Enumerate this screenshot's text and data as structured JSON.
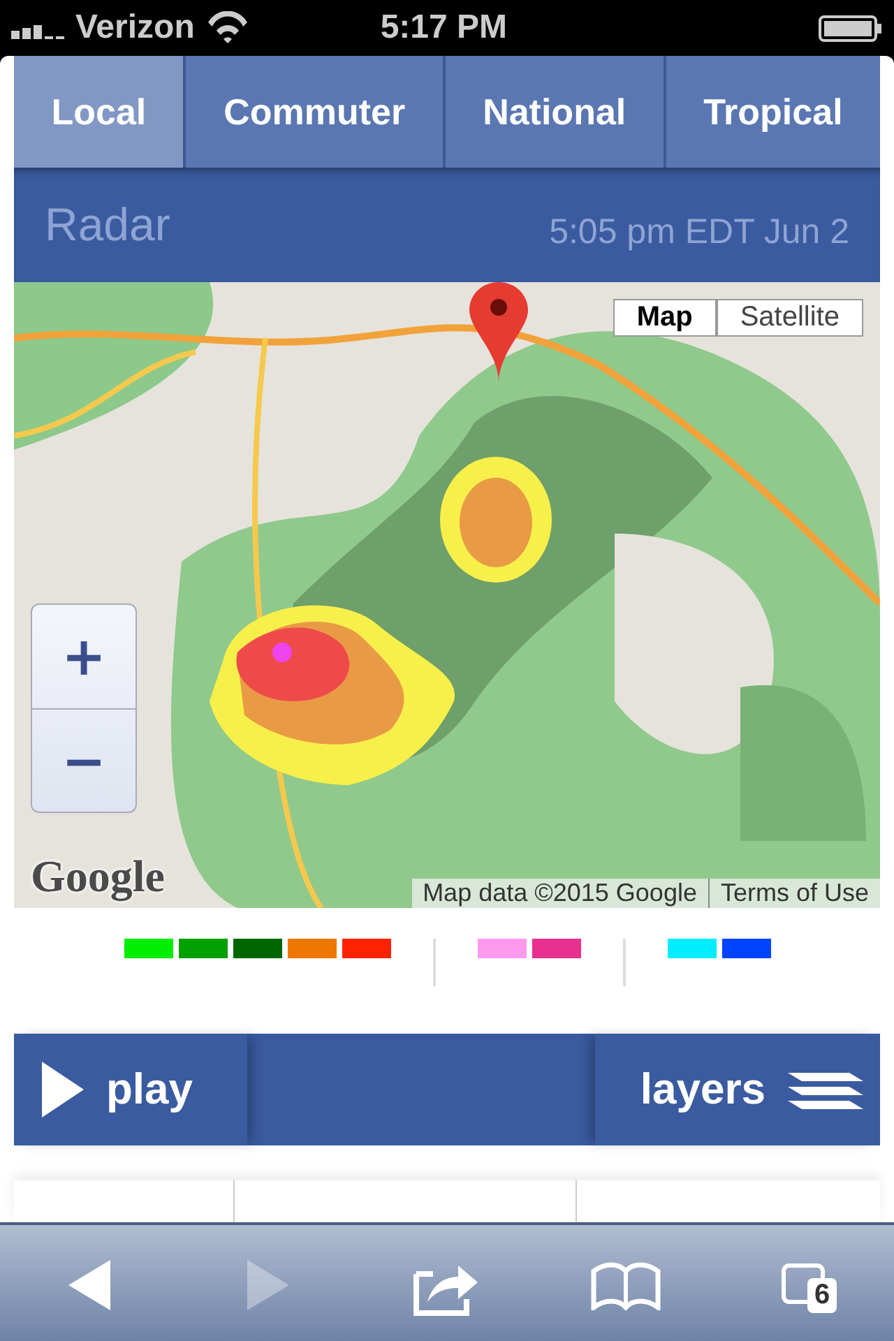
{
  "status_bar": {
    "carrier": "Verizon",
    "time": "5:17 PM"
  },
  "tabs": [
    {
      "label": "Local",
      "selected": true
    },
    {
      "label": "Commuter",
      "selected": false
    },
    {
      "label": "National",
      "selected": false
    },
    {
      "label": "Tropical",
      "selected": false
    }
  ],
  "header": {
    "title": "Radar",
    "timestamp": "5:05 pm EDT Jun 2"
  },
  "map": {
    "kind": "picture",
    "map_types": [
      {
        "label": "Map",
        "selected": true
      },
      {
        "label": "Satellite",
        "selected": false
      }
    ],
    "zoom_in": "+",
    "zoom_out": "−",
    "logo": "Google",
    "attribution": "Map data ©2015 Google",
    "terms": "Terms of Use"
  },
  "legend": [
    [
      {
        "color": "#00ee00"
      },
      {
        "color": "#00a000"
      },
      {
        "color": "#006600"
      },
      {
        "color": "#ee7700"
      },
      {
        "color": "#ff2200"
      }
    ],
    [
      {
        "color": "#ff99ee"
      },
      {
        "color": "#e8308f"
      }
    ],
    [
      {
        "color": "#00eeff"
      },
      {
        "color": "#0044ff"
      }
    ]
  ],
  "controls": {
    "play": "play",
    "layers": "layers"
  },
  "toolbar": [
    {
      "kind": "back",
      "disabled": false
    },
    {
      "kind": "forward",
      "disabled": true
    },
    {
      "kind": "share",
      "disabled": false
    },
    {
      "kind": "bookmarks",
      "disabled": false
    },
    {
      "kind": "tabs",
      "disabled": false,
      "badge": "6"
    }
  ]
}
